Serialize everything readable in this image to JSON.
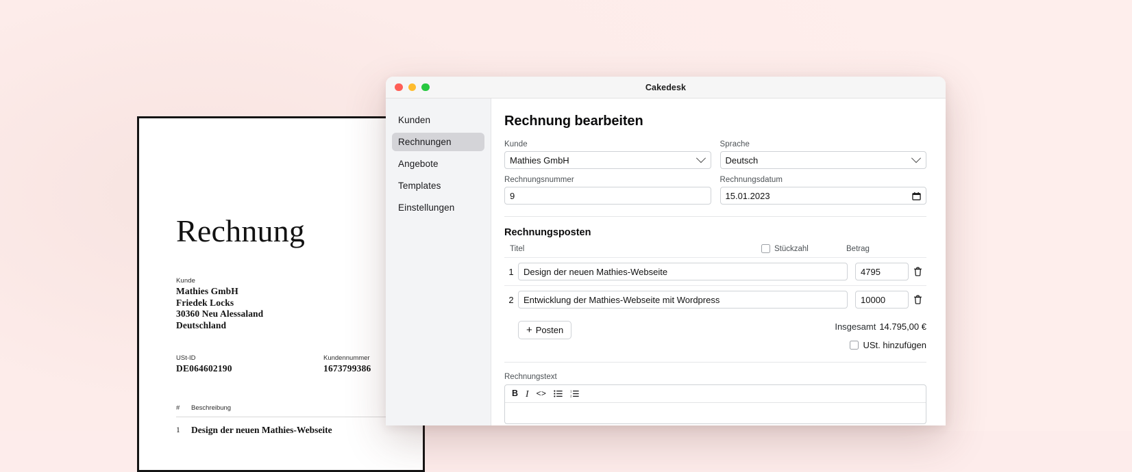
{
  "window": {
    "title": "Cakedesk",
    "traffic_lights": [
      "close",
      "minimize",
      "maximize"
    ]
  },
  "sidebar": {
    "items": [
      {
        "label": "Kunden",
        "active": false
      },
      {
        "label": "Rechnungen",
        "active": true
      },
      {
        "label": "Angebote",
        "active": false
      },
      {
        "label": "Templates",
        "active": false
      },
      {
        "label": "Einstellungen",
        "active": false
      }
    ]
  },
  "main": {
    "page_title": "Rechnung bearbeiten",
    "fields": {
      "kunde_label": "Kunde",
      "kunde_value": "Mathies GmbH",
      "sprache_label": "Sprache",
      "sprache_value": "Deutsch",
      "rechnungsnummer_label": "Rechnungsnummer",
      "rechnungsnummer_value": "9",
      "rechnungsdatum_label": "Rechnungsdatum",
      "rechnungsdatum_value": "15.01.2023"
    },
    "posten": {
      "section_title": "Rechnungsposten",
      "columns": {
        "titel": "Titel",
        "stueckzahl": "Stückzahl",
        "betrag": "Betrag"
      },
      "stueckzahl_checked": false,
      "rows": [
        {
          "num": "1",
          "titel": "Design der neuen Mathies-Webseite",
          "betrag": "4795"
        },
        {
          "num": "2",
          "titel": "Entwicklung der Mathies-Webseite mit Wordpress",
          "betrag": "10000"
        }
      ],
      "add_button_label": "Posten",
      "total_label": "Insgesamt",
      "total_value": "14.795,00 €",
      "ust_label": "USt. hinzufügen",
      "ust_checked": false
    },
    "rechnungstext": {
      "label": "Rechnungstext",
      "toolbar": [
        {
          "name": "bold",
          "glyph": "B"
        },
        {
          "name": "italic",
          "glyph": "I"
        },
        {
          "name": "code",
          "glyph": "<>"
        },
        {
          "name": "bullet-list",
          "glyph": "☰"
        },
        {
          "name": "numbered-list",
          "glyph": "☰"
        }
      ]
    }
  },
  "document_preview": {
    "title": "Rechnung",
    "kunde_label": "Kunde",
    "address": [
      "Mathies GmbH",
      "Friedek Locks",
      "30360 Neu Alessaland",
      "Deutschland"
    ],
    "ustid_label": "USt-ID",
    "ustid_value": "DE064602190",
    "kundennummer_label": "Kundennummer",
    "kundennummer_value": "1673799386",
    "items_col_num": "#",
    "items_col_desc": "Beschreibung",
    "items": [
      {
        "num": "1",
        "desc": "Design der neuen Mathies-Webseite"
      }
    ]
  },
  "colors": {
    "background": "#fdeceb",
    "sidebar": "#f3f4f6",
    "active_nav": "#d4d4d8",
    "traffic_close": "#ff5f57",
    "traffic_min": "#febc2e",
    "traffic_max": "#28c840"
  }
}
